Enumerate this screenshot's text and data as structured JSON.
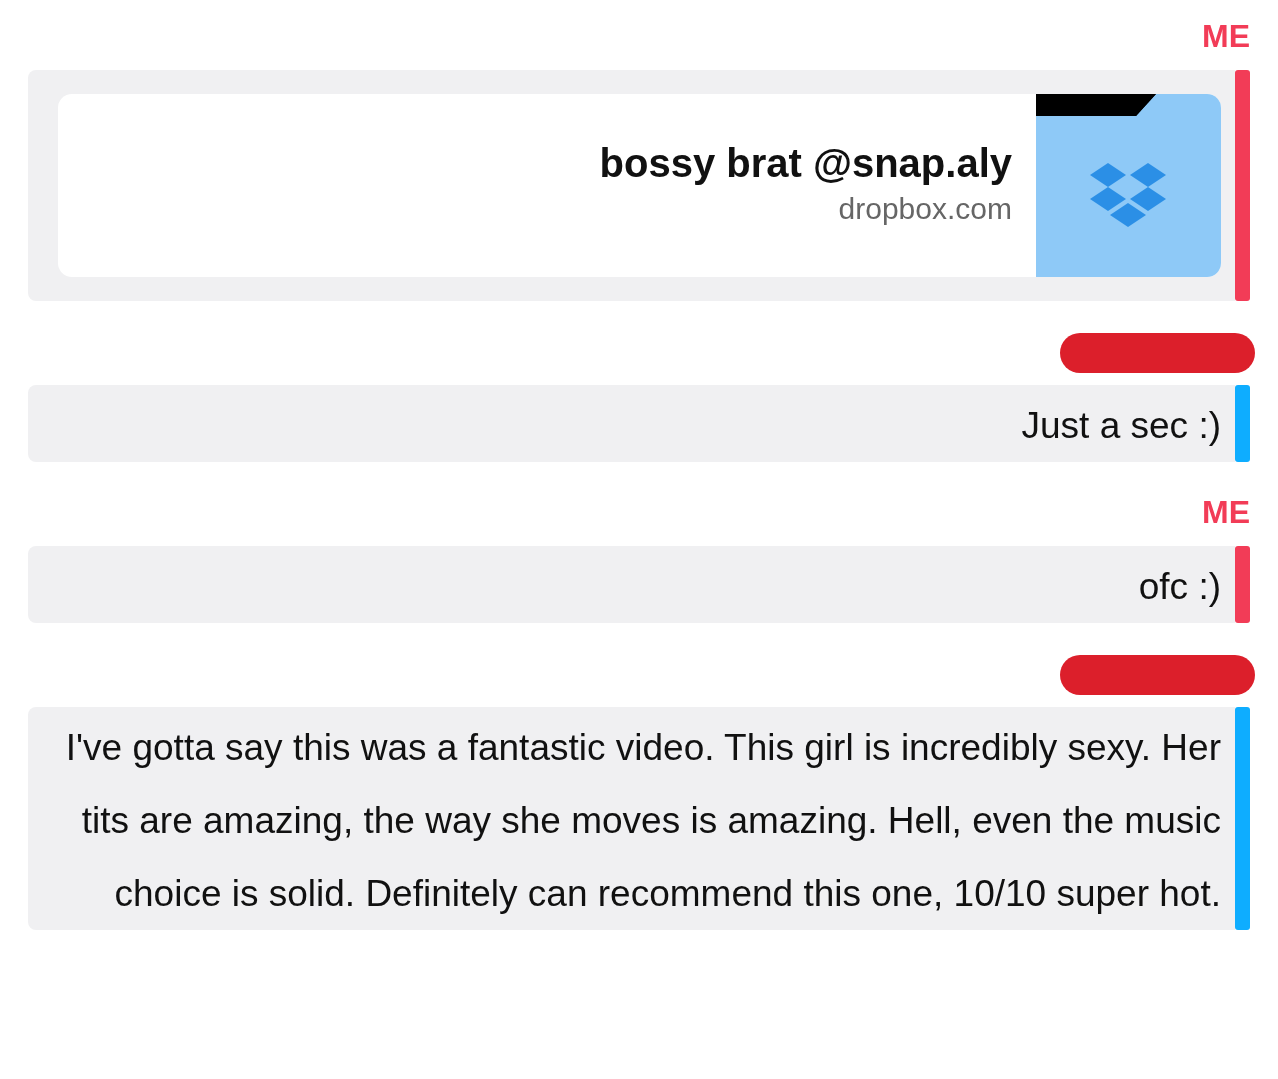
{
  "messages": [
    {
      "kind": "link",
      "sender": "ME",
      "redacted": false,
      "color": "#f23c57",
      "title": "bossy brat @snap.aly",
      "domain": "dropbox.com"
    },
    {
      "kind": "text",
      "redacted": true,
      "color": "#0eadff",
      "text": "Just a sec :)"
    },
    {
      "kind": "text",
      "sender": "ME",
      "redacted": false,
      "color": "#f23c57",
      "text": "ofc :)"
    },
    {
      "kind": "text",
      "redacted": true,
      "color": "#0eadff",
      "text": "I've gotta say this was a fantastic video. This girl is incredibly sexy. Her tits are amazing, the way she moves is amazing. Hell, even the music choice is solid. Definitely can recommend this one, 10/10 super hot."
    }
  ]
}
